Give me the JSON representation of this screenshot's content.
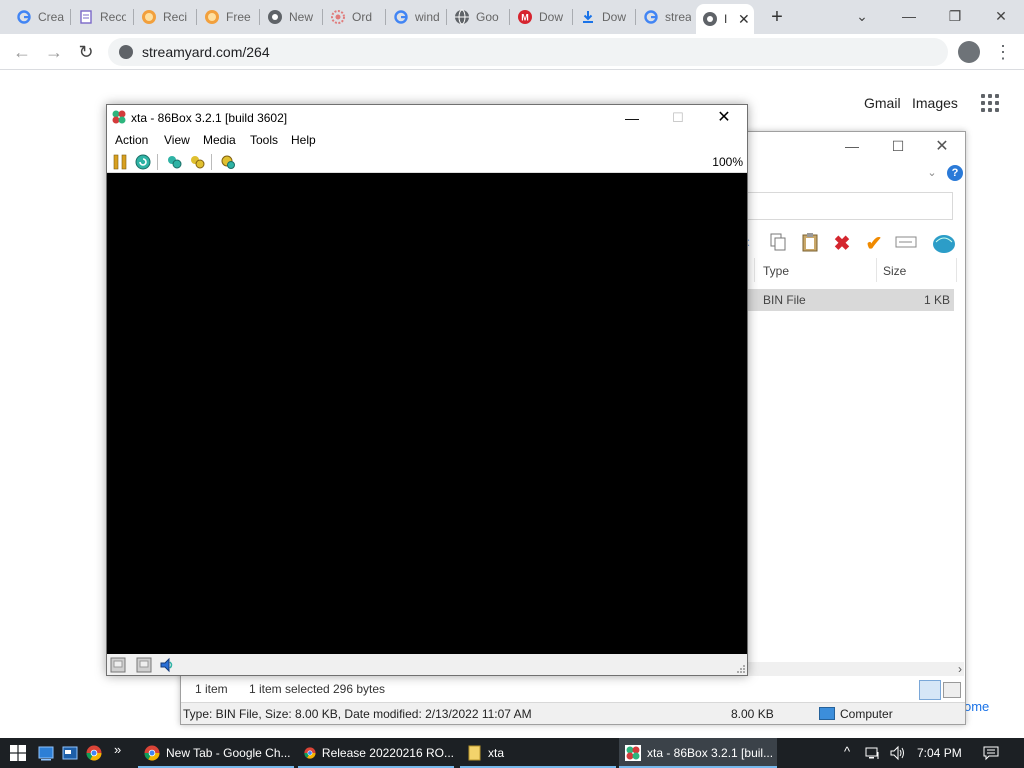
{
  "browser": {
    "tabs": [
      {
        "label": "Crea",
        "favicon": "google-icon"
      },
      {
        "label": "Reco",
        "favicon": "doc-icon"
      },
      {
        "label": "Reci",
        "favicon": "food-icon"
      },
      {
        "label": "Free",
        "favicon": "food-icon"
      },
      {
        "label": "New",
        "favicon": "chrome-icon"
      },
      {
        "label": "Ord",
        "favicon": "gear-flower-icon"
      },
      {
        "label": "wind",
        "favicon": "google-icon"
      },
      {
        "label": "Goo",
        "favicon": "globe-icon"
      },
      {
        "label": "Dow",
        "favicon": "m-icon"
      },
      {
        "label": "Dow",
        "favicon": "download-icon"
      },
      {
        "label": "strea",
        "favicon": "google-icon"
      },
      {
        "label": "I",
        "favicon": "chrome-icon",
        "active": true
      }
    ],
    "new_tab_symbol": "+",
    "window_controls": {
      "minimize": "—",
      "maximize": "❐",
      "close": "✕",
      "tab_search": "⌄"
    },
    "nav": {
      "back": "←",
      "forward": "→",
      "reload": "↻"
    },
    "url": "streamyard.com/264",
    "menu_symbol": "⋮"
  },
  "page": {
    "gmail": "Gmail",
    "images": "Images",
    "footer_fragment": "ome"
  },
  "explorer": {
    "controls": {
      "minimize": "—",
      "maximize": "☐",
      "close": "✕",
      "chevron": "⌄",
      "help": "?"
    },
    "columns": {
      "type": "Type",
      "size": "Size"
    },
    "row": {
      "type": "BIN File",
      "size": "1 KB"
    },
    "scroll_arrow": "›",
    "status": {
      "count": "1 item",
      "selected": "1 item selected",
      "bytes": "296 bytes"
    },
    "infobar": {
      "text": "Type: BIN File, Size: 8.00 KB, Date modified: 2/13/2022 11:07 AM",
      "size": "8.00 KB",
      "location": "Computer"
    }
  },
  "box86": {
    "title": "xta - 86Box 3.2.1 [build 3602]",
    "controls": {
      "minimize": "—",
      "maximize": "☐",
      "close": "✕"
    },
    "menu": [
      "Action",
      "View",
      "Media",
      "Tools",
      "Help"
    ],
    "zoom": "100%"
  },
  "taskbar": {
    "apps": [
      {
        "label": "New Tab - Google Ch...",
        "icon": "chrome-icon"
      },
      {
        "label": "Release 20220216 RO...",
        "icon": "chrome-icon"
      },
      {
        "label": "xta",
        "icon": "folder-icon"
      },
      {
        "label": "xta - 86Box 3.2.1 [buil...",
        "icon": "86box-icon",
        "active": true
      }
    ],
    "overflow_symbol": "»",
    "tray_chevron": "^",
    "time": "7:04 PM"
  },
  "colors": {
    "tabstrip": "#dee1e6",
    "taskbar": "#1c2024",
    "accent": "#76b9ed",
    "emulator_screen": "#000000"
  }
}
